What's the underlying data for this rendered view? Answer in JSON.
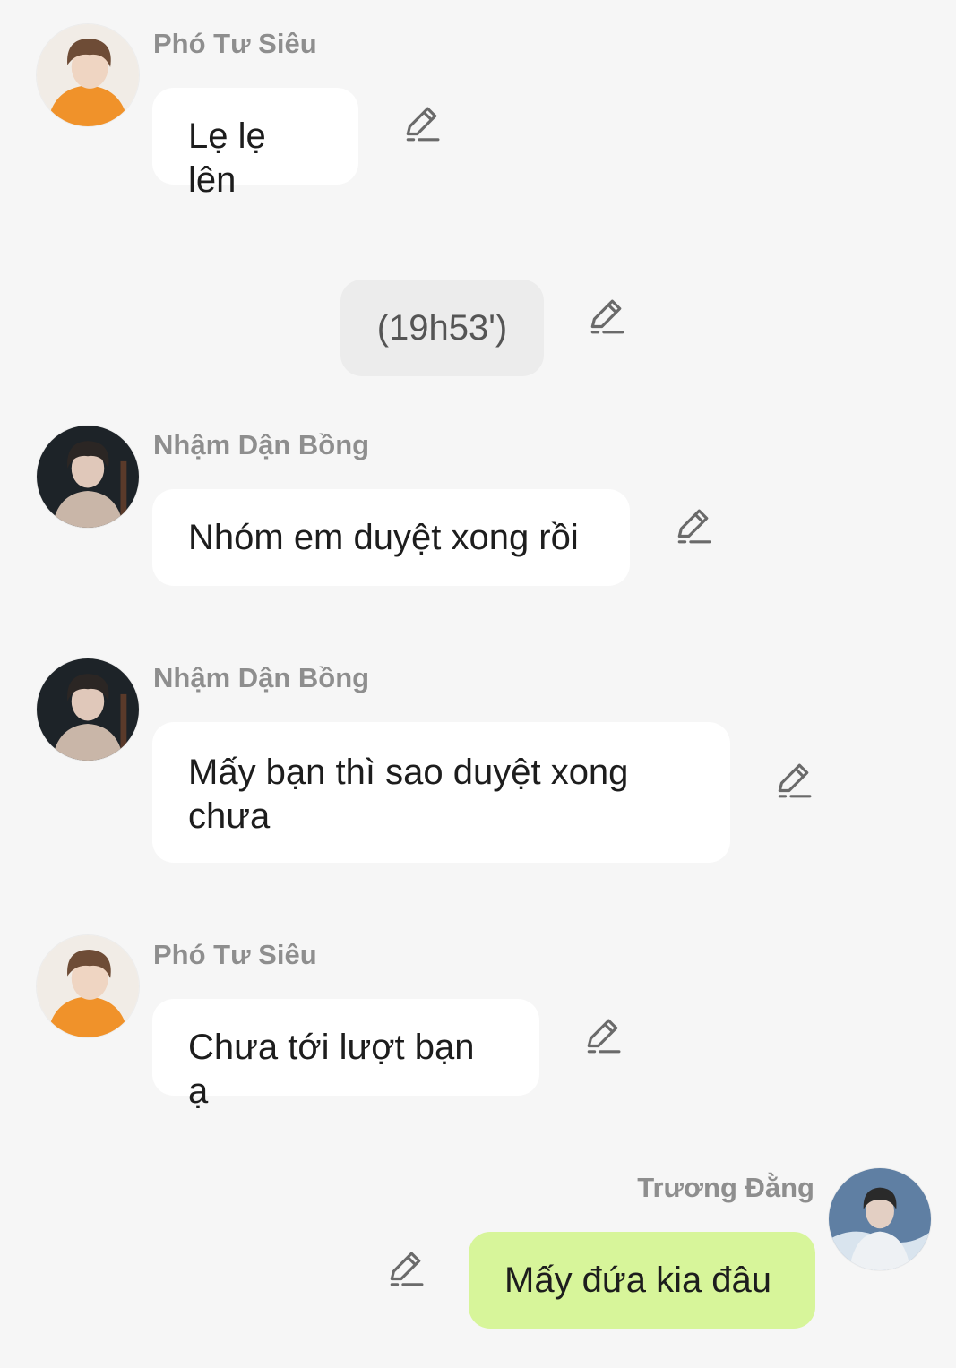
{
  "colors": {
    "background": "#f6f6f6",
    "bubble_incoming": "#ffffff",
    "bubble_outgoing": "#d7f59a",
    "bubble_system": "#ececec",
    "sender_name": "#8e8e8e"
  },
  "edit_icon": "pencil-edit-icon",
  "messages": [
    {
      "type": "incoming",
      "sender": "Phó Tư Siêu",
      "text": "Lẹ lẹ lên",
      "avatar": "orange-hoodie-avatar"
    },
    {
      "type": "system",
      "text": "(19h53')"
    },
    {
      "type": "incoming",
      "sender": "Nhậm Dận Bồng",
      "text": "Nhóm em duyệt xong rồi",
      "avatar": "dark-portrait-avatar"
    },
    {
      "type": "incoming",
      "sender": "Nhậm Dận Bồng",
      "text": "Mấy bạn thì sao duyệt xong chưa",
      "avatar": "dark-portrait-avatar"
    },
    {
      "type": "incoming",
      "sender": "Phó Tư Siêu",
      "text": "Chưa tới lượt bạn ạ",
      "avatar": "orange-hoodie-avatar"
    },
    {
      "type": "outgoing",
      "sender": "Trương Đằng",
      "text": "Mấy đứa kia đâu",
      "avatar": "blue-sea-avatar"
    }
  ]
}
